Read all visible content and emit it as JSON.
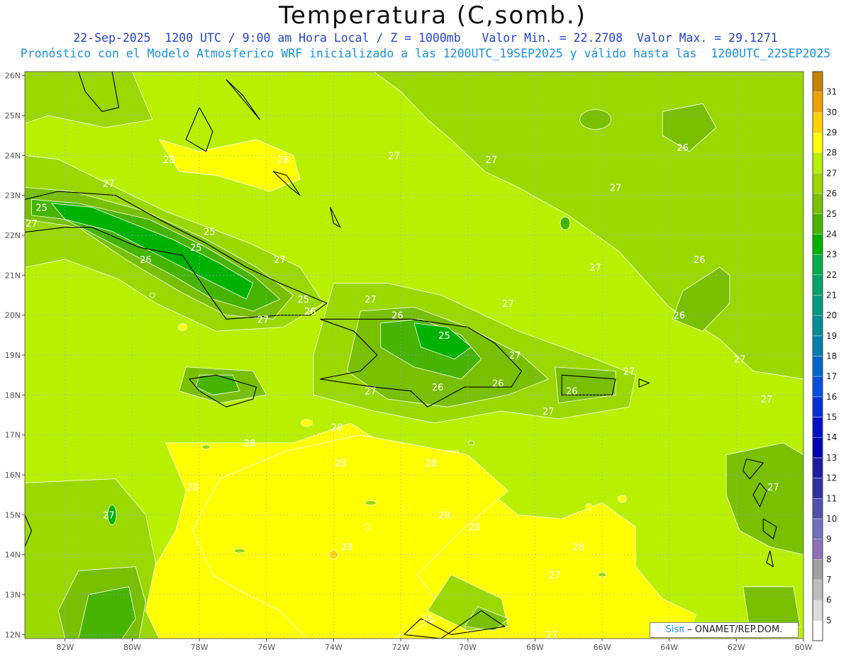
{
  "header": {
    "title": "Temperatura (C,somb.)",
    "subtitle1": "22-Sep-2025  1200 UTC / 9:00 am Hora Local / Z = 1000mb   Valor Min. = 22.2708  Valor Max. = 29.1271",
    "subtitle2": "Pronóstico con el Modelo Atmosferico WRF inicializado a las 1200UTC_19SEP2025 y válido hasta las  1200UTC_22SEP2025"
  },
  "map": {
    "lon_range": [
      -83.2,
      -60
    ],
    "lat_range": [
      11.9,
      26.1
    ],
    "lon_ticks": [
      -82,
      -80,
      -78,
      -76,
      -74,
      -72,
      -70,
      -68,
      -66,
      -64,
      -62,
      -60
    ],
    "lon_labels": [
      "82W",
      "80W",
      "78W",
      "76W",
      "74W",
      "72W",
      "70W",
      "68W",
      "66W",
      "64W",
      "62W",
      "60W"
    ],
    "lat_ticks": [
      12,
      13,
      14,
      15,
      16,
      17,
      18,
      19,
      20,
      21,
      22,
      23,
      24,
      25,
      26
    ],
    "lat_labels": [
      "12N",
      "13N",
      "14N",
      "15N",
      "16N",
      "17N",
      "18N",
      "19N",
      "20N",
      "21N",
      "22N",
      "23N",
      "24N",
      "25N",
      "26N"
    ],
    "background_fill": "#b8f000",
    "grid_color": "#9ea0ff",
    "contour_labels": [
      {
        "text": "28",
        "lon": -78.9,
        "lat": 23.9
      },
      {
        "text": "28",
        "lon": -75.5,
        "lat": 23.9
      },
      {
        "text": "27",
        "lon": -80.7,
        "lat": 23.3
      },
      {
        "text": "25",
        "lon": -82.7,
        "lat": 22.7
      },
      {
        "text": "27",
        "lon": -83.0,
        "lat": 22.3
      },
      {
        "text": "25",
        "lon": -77.7,
        "lat": 22.1
      },
      {
        "text": "25",
        "lon": -78.1,
        "lat": 21.7
      },
      {
        "text": "26",
        "lon": -79.6,
        "lat": 21.4
      },
      {
        "text": "27",
        "lon": -75.6,
        "lat": 21.4
      },
      {
        "text": "25",
        "lon": -74.9,
        "lat": 20.4
      },
      {
        "text": "26",
        "lon": -74.7,
        "lat": 20.1
      },
      {
        "text": "27",
        "lon": -76.1,
        "lat": 19.9
      },
      {
        "text": "27",
        "lon": -72.9,
        "lat": 20.4
      },
      {
        "text": "26",
        "lon": -72.1,
        "lat": 20.0
      },
      {
        "text": "25",
        "lon": -70.7,
        "lat": 19.5
      },
      {
        "text": "27",
        "lon": -68.6,
        "lat": 19.0
      },
      {
        "text": "27",
        "lon": -72.2,
        "lat": 24.0
      },
      {
        "text": "27",
        "lon": -69.3,
        "lat": 23.9
      },
      {
        "text": "27",
        "lon": -65.6,
        "lat": 23.2
      },
      {
        "text": "26",
        "lon": -63.6,
        "lat": 24.2
      },
      {
        "text": "27",
        "lon": -66.2,
        "lat": 21.2
      },
      {
        "text": "26",
        "lon": -63.1,
        "lat": 21.4
      },
      {
        "text": "27",
        "lon": -68.8,
        "lat": 20.3
      },
      {
        "text": "26",
        "lon": -63.7,
        "lat": 20.0
      },
      {
        "text": "27",
        "lon": -65.2,
        "lat": 18.6
      },
      {
        "text": "27",
        "lon": -61.9,
        "lat": 18.9
      },
      {
        "text": "26",
        "lon": -66.9,
        "lat": 18.1
      },
      {
        "text": "26",
        "lon": -69.1,
        "lat": 18.3
      },
      {
        "text": "26",
        "lon": -70.9,
        "lat": 18.2
      },
      {
        "text": "27",
        "lon": -72.9,
        "lat": 18.1
      },
      {
        "text": "27",
        "lon": -67.6,
        "lat": 17.6
      },
      {
        "text": "27",
        "lon": -61.1,
        "lat": 17.9
      },
      {
        "text": "28",
        "lon": -73.9,
        "lat": 17.2
      },
      {
        "text": "28",
        "lon": -76.5,
        "lat": 16.8
      },
      {
        "text": "28",
        "lon": -73.8,
        "lat": 16.3
      },
      {
        "text": "28",
        "lon": -71.1,
        "lat": 16.3
      },
      {
        "text": "28",
        "lon": -78.2,
        "lat": 15.7
      },
      {
        "text": "27",
        "lon": -60.9,
        "lat": 15.7
      },
      {
        "text": "27",
        "lon": -80.7,
        "lat": 15.0
      },
      {
        "text": "28",
        "lon": -70.7,
        "lat": 15.0
      },
      {
        "text": "28",
        "lon": -69.8,
        "lat": 14.7
      },
      {
        "text": "28",
        "lon": -66.7,
        "lat": 14.2
      },
      {
        "text": "28",
        "lon": -73.6,
        "lat": 14.2
      },
      {
        "text": "27",
        "lon": -67.4,
        "lat": 13.5
      },
      {
        "text": "28",
        "lon": -71.2,
        "lat": 12.4
      },
      {
        "text": "27",
        "lon": -67.5,
        "lat": 12.0
      }
    ]
  },
  "colorbar": {
    "labels": [
      "5",
      "6",
      "7",
      "8",
      "9",
      "10",
      "11",
      "12",
      "13",
      "14",
      "15",
      "16",
      "17",
      "18",
      "19",
      "20",
      "21",
      "22",
      "23",
      "24",
      "25",
      "26",
      "27",
      "28",
      "29",
      "30",
      "31"
    ],
    "colors": [
      "#ffffff",
      "#dcdcdc",
      "#bcbcbc",
      "#a0a0a0",
      "#8e70b8",
      "#7070c0",
      "#5050b0",
      "#3030a0",
      "#1c1ca0",
      "#0000b4",
      "#0010c8",
      "#0030d8",
      "#0050e0",
      "#0068cc",
      "#0080b0",
      "#008e98",
      "#009a80",
      "#00a468",
      "#00ae4c",
      "#00b200",
      "#46b400",
      "#78c000",
      "#9ad800",
      "#b8f000",
      "#ffff00",
      "#ffd200",
      "#f0a000",
      "#c88200"
    ]
  },
  "credit": {
    "brand": "Sisπ",
    "text": "– ONAMET/REP.DOM."
  }
}
